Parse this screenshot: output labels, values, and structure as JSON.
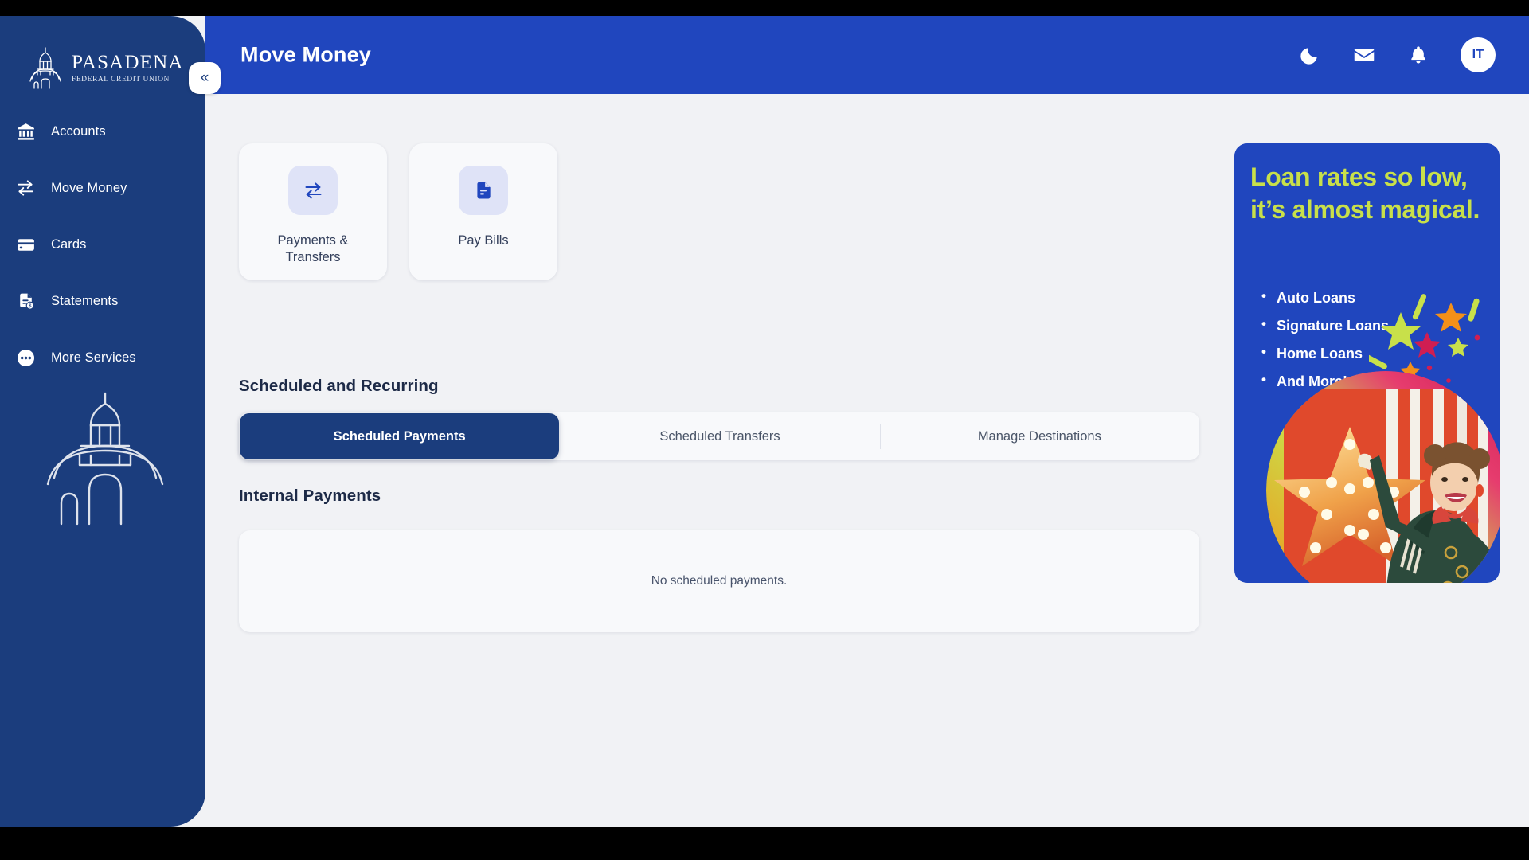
{
  "brand": {
    "name": "PASADENA",
    "subtitle": "FEDERAL CREDIT UNION",
    "logo_icon": "city-hall-dome-icon",
    "watermark_icon": "city-hall-dome-watermark-icon",
    "sidebar_color": "#1b3d7d",
    "header_color": "#2046be"
  },
  "sidebar": {
    "collapse_label": "«",
    "items": [
      {
        "label": "Accounts",
        "icon": "bank-icon"
      },
      {
        "label": "Move Money",
        "icon": "transfer-arrows-icon"
      },
      {
        "label": "Cards",
        "icon": "credit-card-icon"
      },
      {
        "label": "Statements",
        "icon": "document-dollar-icon"
      },
      {
        "label": "More Services",
        "icon": "more-dots-icon"
      }
    ]
  },
  "header": {
    "title": "Move Money",
    "actions": [
      {
        "name": "dark-mode-toggle",
        "icon": "moon-icon"
      },
      {
        "name": "messages-button",
        "icon": "envelope-icon"
      },
      {
        "name": "notifications-button",
        "icon": "bell-icon"
      }
    ],
    "avatar_initials": "IT"
  },
  "main": {
    "quick_actions": [
      {
        "label": "Payments & Transfers",
        "icon": "transfer-arrows-icon"
      },
      {
        "label": "Pay Bills",
        "icon": "bill-document-icon"
      }
    ],
    "scheduled_section_title": "Scheduled and Recurring",
    "tabs": [
      {
        "label": "Scheduled Payments",
        "active": true
      },
      {
        "label": "Scheduled Transfers",
        "active": false
      },
      {
        "label": "Manage Destinations",
        "active": false
      }
    ],
    "internal_section_title": "Internal Payments",
    "empty_state_text": "No scheduled payments."
  },
  "promo": {
    "headline": "Loan rates so low, it’s almost magical.",
    "bullets": [
      "Auto Loans",
      "Signature Loans",
      "Home Loans",
      "And More!"
    ],
    "headline_color": "#c8e04a",
    "background_color": "#2046be",
    "image_alt": "circus-performer-photo"
  }
}
